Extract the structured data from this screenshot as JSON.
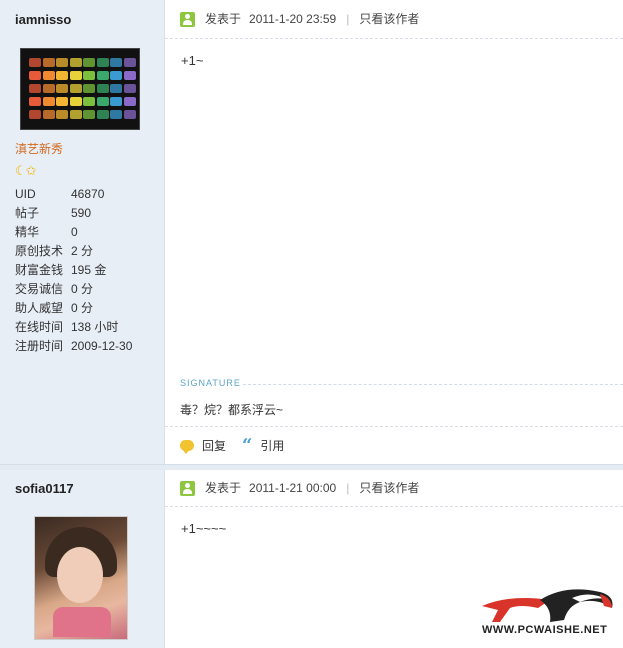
{
  "posts": [
    {
      "author": "iamnisso",
      "rank": "滇艺新秀",
      "stats": [
        {
          "label": "UID",
          "value": "46870"
        },
        {
          "label": "帖子",
          "value": "590"
        },
        {
          "label": "精华",
          "value": "0"
        },
        {
          "label": "原创技术",
          "value": "2 分"
        },
        {
          "label": "财富金钱",
          "value": "195 金"
        },
        {
          "label": "交易诚信",
          "value": "0 分"
        },
        {
          "label": "助人威望",
          "value": "0 分"
        },
        {
          "label": "在线时间",
          "value": "138 小时"
        },
        {
          "label": "注册时间",
          "value": "2009-12-30"
        }
      ],
      "posted_prefix": "发表于",
      "posted_time": "2011-1-20 23:59",
      "only_author": "只看该作者",
      "message": "+1~",
      "signature_label": "SIGNATURE",
      "signature": "毒？烷？都系浮云~",
      "reply_label": "回复",
      "quote_label": "引用"
    },
    {
      "author": "sofia0117",
      "posted_prefix": "发表于",
      "posted_time": "2011-1-21 00:00",
      "only_author": "只看该作者",
      "message": "+1~~~~"
    }
  ],
  "watermark": "WWW.PCWAISHE.NET",
  "colors": {
    "sidebar": "#e7eef6",
    "rank": "#d2691e",
    "user_icon": "#8fc640",
    "signature": "#5aa6c8",
    "watermark_red": "#d8342a"
  },
  "icons": [
    "user-icon",
    "moon-icon",
    "star-icon",
    "reply-bubble-icon",
    "quote-icon",
    "pcwaishe-eagle-logo"
  ]
}
